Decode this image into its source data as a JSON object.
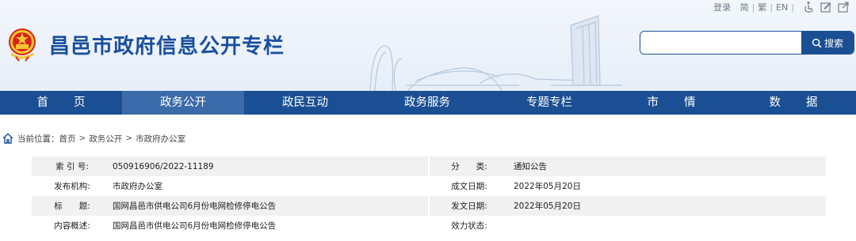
{
  "site": {
    "title": "昌邑市政府信息公开专栏"
  },
  "toplinks": {
    "login": "登录",
    "simplified": "简",
    "traditional": "繁",
    "english": "EN",
    "separator": "|",
    "icons": [
      "accessibility-icon",
      "edit-icon",
      "share-icon"
    ]
  },
  "search": {
    "placeholder": "",
    "value": "",
    "button_label": "搜索"
  },
  "nav": {
    "items": [
      {
        "label": "首页",
        "active": false
      },
      {
        "label": "政务公开",
        "active": true
      },
      {
        "label": "政民互动",
        "active": false
      },
      {
        "label": "政务服务",
        "active": false
      },
      {
        "label": "专题专栏",
        "active": false
      },
      {
        "label": "市情",
        "active": false
      },
      {
        "label": "数据",
        "active": false
      }
    ]
  },
  "breadcrumb": {
    "prefix": "当前位置：",
    "items": [
      "首页",
      "政务公开",
      "市政府办公室"
    ],
    "separator": ">"
  },
  "meta": {
    "rows": [
      {
        "k1": "索 引 号:",
        "v1": "050916906/2022-11189",
        "k2": "分　　类:",
        "v2": "通知公告"
      },
      {
        "k1": "发布机构:",
        "v1": "市政府办公室",
        "k2": "成文日期:",
        "v2": "2022年05月20日"
      },
      {
        "k1": "标　　题:",
        "v1": "国网昌邑市供电公司6月份电网检修停电公告",
        "k2": "发文日期:",
        "v2": "2022年05月20日"
      },
      {
        "k1": "内容概述:",
        "v1": "国网昌邑市供电公司6月份电网检修停电公告",
        "k2": "效力状态:",
        "v2": ""
      }
    ]
  },
  "colors": {
    "brand": "#1a4f93",
    "active_nav": "#3b6ba8",
    "title": "#1a4f9c"
  }
}
